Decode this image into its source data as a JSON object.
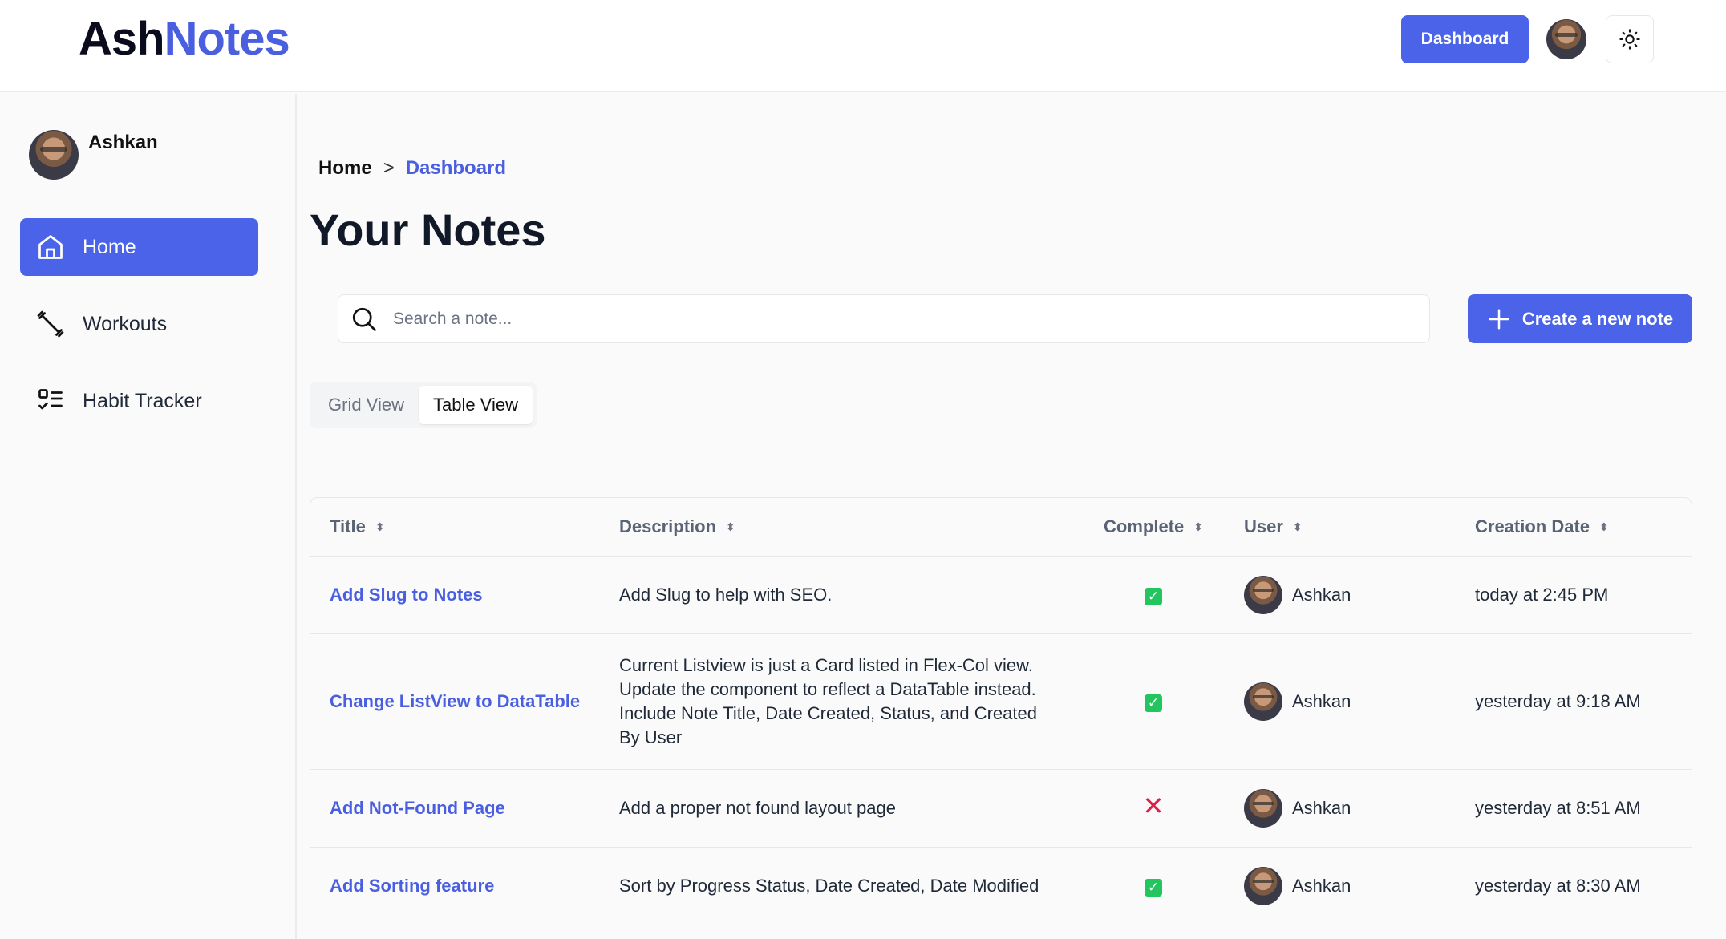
{
  "header": {
    "logo_part1": "Ash",
    "logo_part2": "Notes",
    "dashboard_label": "Dashboard"
  },
  "sidebar": {
    "user_name": "Ashkan",
    "items": [
      {
        "label": "Home",
        "icon": "home-icon",
        "active": true
      },
      {
        "label": "Workouts",
        "icon": "dumbbell-icon",
        "active": false
      },
      {
        "label": "Habit Tracker",
        "icon": "checklist-icon",
        "active": false
      }
    ]
  },
  "breadcrumb": {
    "home": "Home",
    "separator": ">",
    "current": "Dashboard"
  },
  "page_title": "Your Notes",
  "search": {
    "placeholder": "Search a note..."
  },
  "create_label": "Create a new note",
  "view_toggle": {
    "grid": "Grid View",
    "table": "Table View",
    "selected": "Table View"
  },
  "table": {
    "columns": [
      "Title",
      "Description",
      "Complete",
      "User",
      "Creation Date"
    ],
    "rows": [
      {
        "title": "Add Slug to Notes",
        "description": "Add Slug to help with SEO.",
        "complete": true,
        "user": "Ashkan",
        "date": "today at 2:45 PM"
      },
      {
        "title": "Change ListView to DataTable",
        "description": "Current Listview is just a Card listed in Flex-Col view. Update the component to reflect a DataTable instead. Include Note Title, Date Created, Status, and Created By User",
        "complete": true,
        "user": "Ashkan",
        "date": "yesterday at 9:18 AM"
      },
      {
        "title": "Add Not-Found Page",
        "description": "Add a proper not found layout page",
        "complete": false,
        "user": "Ashkan",
        "date": "yesterday at 8:51 AM"
      },
      {
        "title": "Add Sorting feature",
        "description": "Sort by Progress Status, Date Created, Date Modified",
        "complete": true,
        "user": "Ashkan",
        "date": "yesterday at 8:30 AM"
      }
    ]
  },
  "colors": {
    "accent": "#4a63e8",
    "complete": "#22c55e",
    "incomplete": "#e11d48"
  }
}
